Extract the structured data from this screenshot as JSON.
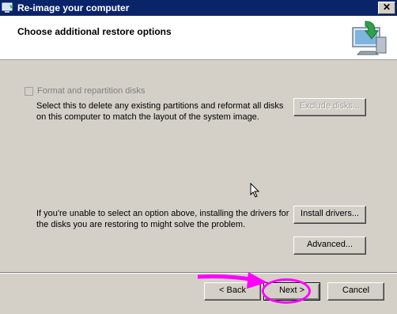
{
  "window": {
    "title": "Re-image your computer",
    "close_label": "✕"
  },
  "header": {
    "title": "Choose additional restore options"
  },
  "format_option": {
    "label": "Format and repartition disks",
    "description": "Select this to delete any existing partitions and reformat all disks on this computer to match the layout of the system image.",
    "checked": false,
    "enabled": false
  },
  "exclude_button": {
    "label": "Exclude disks..."
  },
  "drivers_text": "If you're unable to select an option above, installing the drivers for the disks you are restoring to might solve the problem.",
  "install_button": {
    "label": "Install drivers..."
  },
  "advanced_button": {
    "label": "Advanced..."
  },
  "footer": {
    "back_label": "< Back",
    "next_label": "Next >",
    "cancel_label": "Cancel"
  },
  "annotation_color": "#ff00ff"
}
